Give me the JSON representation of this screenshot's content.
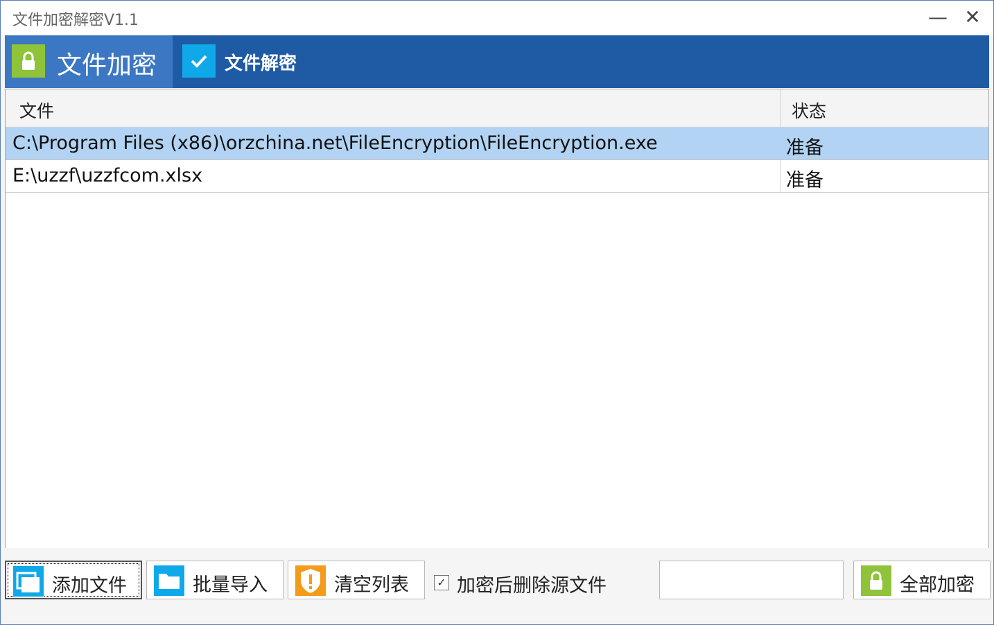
{
  "window": {
    "title": "文件加密解密V1.1",
    "minimize": "—",
    "close": "✕"
  },
  "tabs": [
    {
      "label": "文件加密",
      "icon": "lock-icon",
      "active": true
    },
    {
      "label": "文件解密",
      "icon": "check-icon",
      "active": false
    }
  ],
  "table": {
    "columns": [
      "文件",
      "状态"
    ],
    "rows": [
      {
        "file": "C:\\Program Files (x86)\\orzchina.net\\FileEncryption\\FileEncryption.exe",
        "status": "准备",
        "selected": true
      },
      {
        "file": "E:\\uzzf\\uzzfcom.xlsx",
        "status": "准备",
        "selected": false
      }
    ]
  },
  "footer": {
    "add_file": "添加文件",
    "batch_import": "批量导入",
    "clear_list": "清空列表",
    "delete_source_checkbox": {
      "label": "加密后删除源文件",
      "checked": true,
      "mark": "✓"
    },
    "password_value": "",
    "encrypt_all": "全部加密"
  },
  "colors": {
    "tab_bar": "#1f5aa5",
    "active_tab": "#3b77c3",
    "selected_row": "#b2d3f3",
    "green_icon": "#8fc33a",
    "blue_icon": "#0fa8e8",
    "orange_icon": "#f39b1a"
  }
}
